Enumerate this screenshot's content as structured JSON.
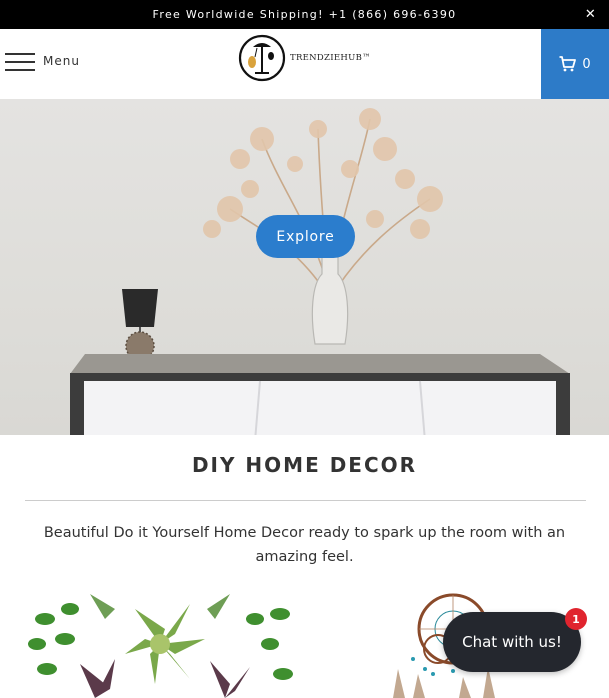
{
  "announcement": {
    "text": "Free Worldwide Shipping! +1 (866) 696-6390",
    "close_icon": "close-icon"
  },
  "header": {
    "menu_label": "Menu",
    "logo_text": "TRENDZIEHUB™",
    "cart_count": "0",
    "cart_color": "#2d7bc8"
  },
  "hero": {
    "button_label": "Explore",
    "button_color": "#2b7dcd"
  },
  "section": {
    "title": "DIY HOME DECOR",
    "description": "Beautiful Do it Yourself Home Decor ready to spark up the room with an amazing feel."
  },
  "chat": {
    "label": "Chat with us!",
    "badge_count": "1",
    "badge_color": "#e0242e"
  }
}
